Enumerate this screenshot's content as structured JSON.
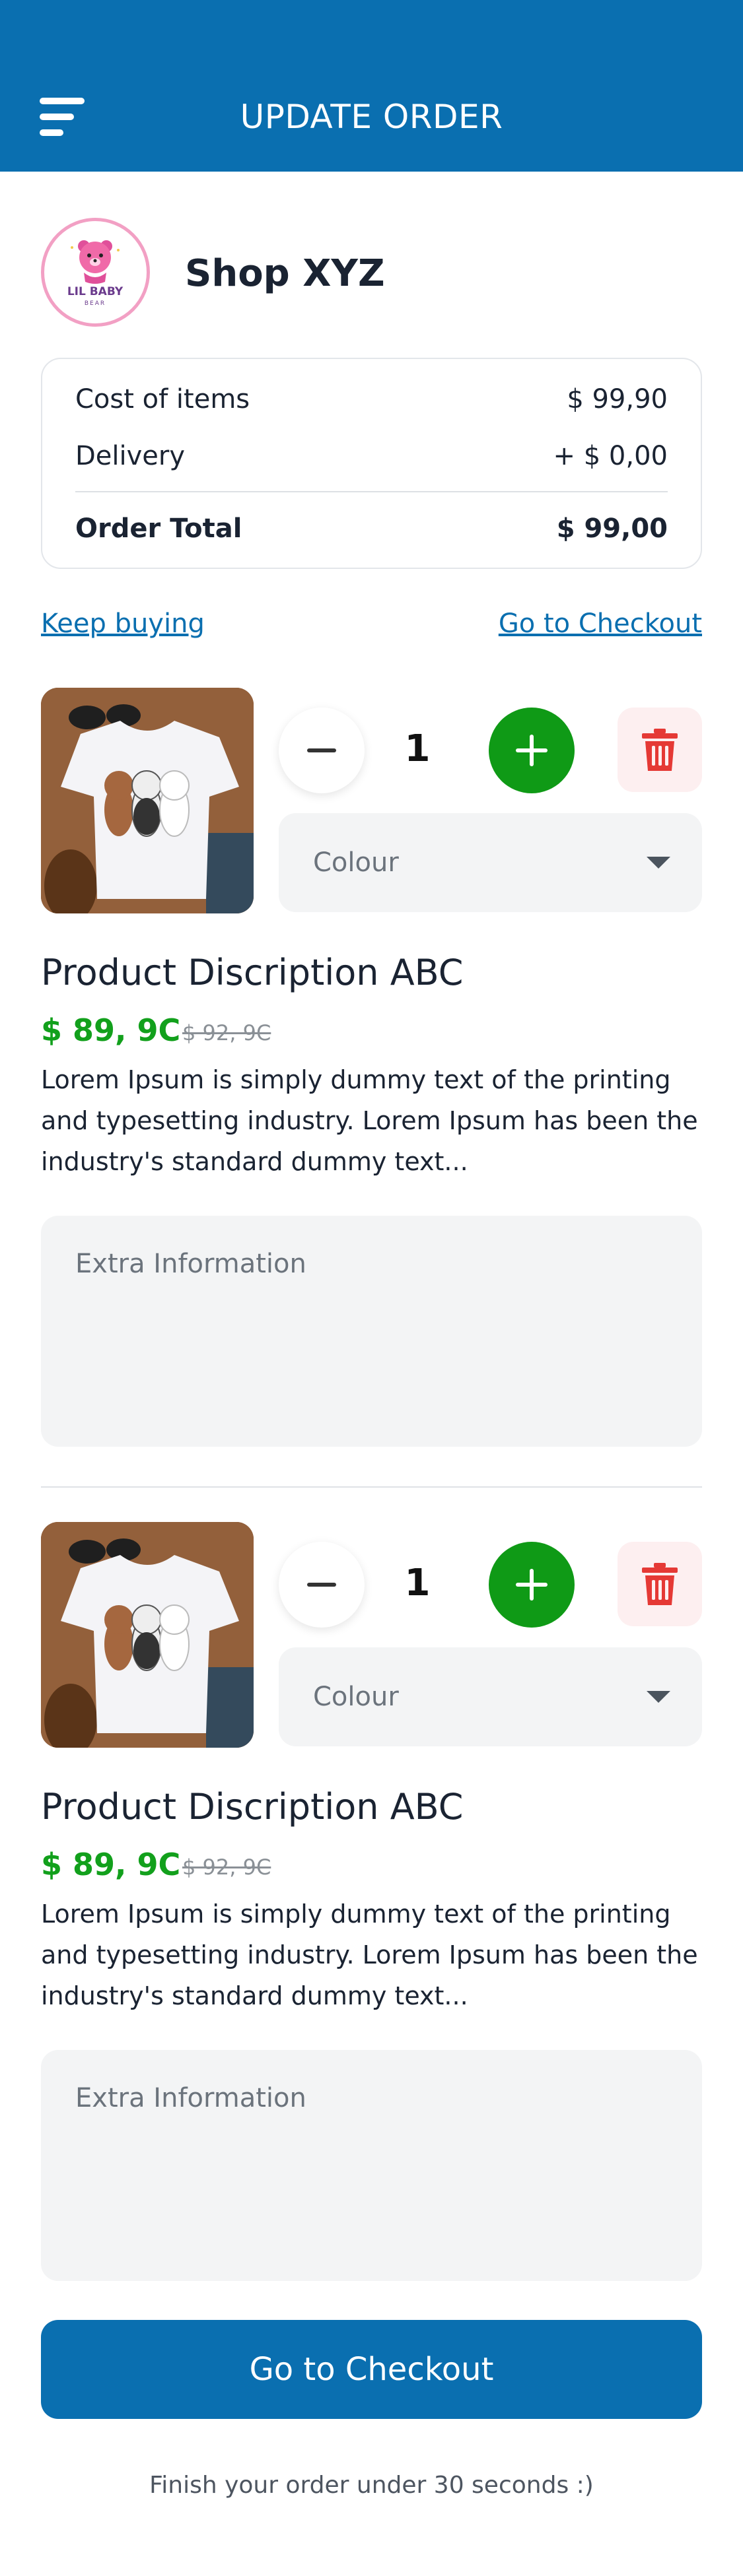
{
  "header": {
    "title": "UPDATE ORDER",
    "menu_icon": "hamburger-menu-icon"
  },
  "shop": {
    "name": "Shop XYZ",
    "logo_text": "LIL BABY BEAR"
  },
  "summary": {
    "cost_label": "Cost of items",
    "cost_value": "$ 99,90",
    "delivery_label": "Delivery",
    "delivery_value": "+ $ 0,00",
    "total_label": "Order Total",
    "total_value": "$ 99,00"
  },
  "links": {
    "keep_buying": "Keep buying ",
    "go_to_checkout": "Go to Checkout"
  },
  "items": [
    {
      "quantity": "1",
      "colour_label": "Colour",
      "title": "Product Discription ABC",
      "price": "$ 89, 9C",
      "old_price": "$ 92, 9C",
      "description": "Lorem Ipsum is simply dummy text of the printing and typesetting industry. Lorem Ipsum has been the industry's standard dummy text...",
      "extra_placeholder": "Extra Information"
    },
    {
      "quantity": "1",
      "colour_label": "Colour",
      "title": "Product Discription ABC",
      "price": "$ 89, 9C",
      "old_price": "$ 92, 9C",
      "description": "Lorem Ipsum is simply dummy text of the printing and typesetting industry. Lorem Ipsum has been the industry's standard dummy text...",
      "extra_placeholder": "Extra Information"
    }
  ],
  "checkout_button": "Go to Checkout",
  "footer_note": "Finish your order under 30 seconds :)",
  "colors": {
    "primary": "#0a6fb0",
    "green": "#12a01c",
    "delete_red": "#e53935",
    "field_bg": "#f3f4f5"
  }
}
